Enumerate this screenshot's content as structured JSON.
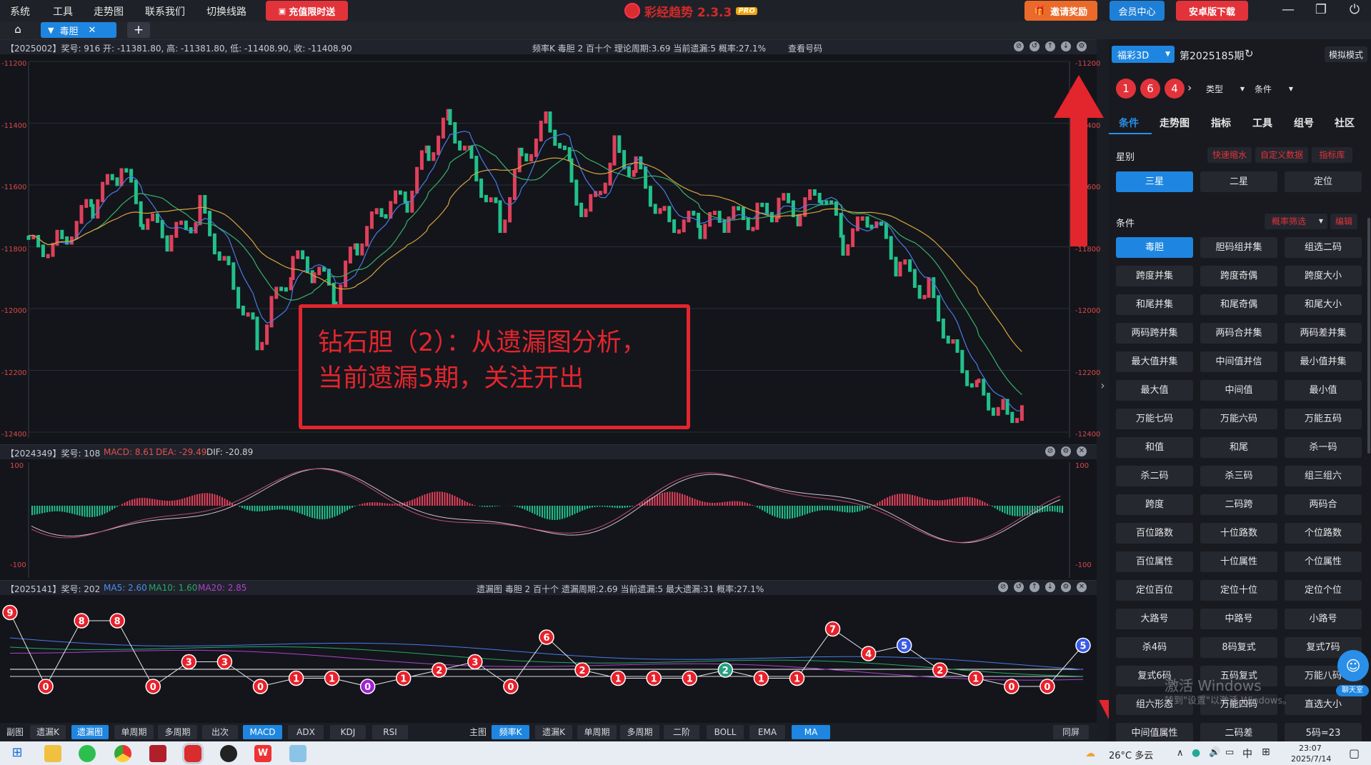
{
  "titlebar": {
    "menu": [
      "系统",
      "工具",
      "走势图",
      "联系我们",
      "切换线路"
    ],
    "promo": "充值限时送",
    "app_title": "彩经趋势 2.3.3",
    "pro": "PRO",
    "invite": "邀请奖励",
    "member": "会员中心",
    "android": "安卓版下载"
  },
  "tabbar": {
    "active_tab": "毒胆"
  },
  "kline_panel": {
    "header_left": "【2025002】奖号: 916  开: -11381.80, 高: -11381.80, 低: -11408.90, 收: -11408.90",
    "header_mid": "频率K   毒胆   2   百十个   理论周期:3.69   当前遗漏:5   概率:27.1%",
    "header_link": "查看号码",
    "y_ticks": [
      "-11200",
      "-11400",
      "-11600",
      "-11800",
      "-12000",
      "-12200",
      "-12400"
    ]
  },
  "macd_panel": {
    "header_prefix": "【2024349】奖号: 108",
    "macd": "MACD: 8.61",
    "dea": "DEA: -29.49",
    "dif": "DIF: -20.89",
    "y_ticks": [
      "100",
      "-100"
    ]
  },
  "miss_panel": {
    "header_prefix": "【2025141】奖号: 202",
    "ma5": "MA5: 2.60",
    "ma10": "MA10: 1.60",
    "ma20": "MA20: 2.85",
    "header_mid": "遗漏图   毒胆   2   百十个   遗漏周期:2.69   当前遗漏:5   最大遗漏:31   概率:27.1%",
    "values": [
      9,
      0,
      8,
      8,
      0,
      3,
      3,
      0,
      1,
      1,
      0,
      1,
      2,
      3,
      0,
      6,
      2,
      1,
      1,
      1,
      2,
      1,
      1,
      7,
      4,
      5,
      2,
      1,
      0,
      0,
      5
    ]
  },
  "toolstrip": {
    "sub_label": "副图",
    "sub_buttons": [
      "遗漏K",
      "遗漏图",
      "单周期",
      "多周期",
      "出次",
      "MACD",
      "ADX",
      "KDJ",
      "RSI"
    ],
    "main_label": "主图",
    "main_buttons": [
      "频率K",
      "遗漏K",
      "单周期",
      "多周期",
      "二阶",
      "BOLL",
      "EMA",
      "MA"
    ],
    "same_screen": "同屏"
  },
  "annotation": {
    "line1": "钻石胆（2）：从遗漏图分析，",
    "line2": "当前遗漏5期，关注开出"
  },
  "sidebar": {
    "lottery": "福彩3D",
    "period": "第2025185期",
    "mode": "模拟模式",
    "balls": [
      "1",
      "6",
      "4"
    ],
    "type_select": "类型",
    "cond_select": "条件",
    "tabs": [
      "条件",
      "走势图",
      "指标",
      "工具",
      "组号",
      "社区"
    ],
    "star_label": "星别",
    "star_links": [
      "快速缩水",
      "自定义数据",
      "指标库"
    ],
    "star_buttons": [
      "三星",
      "二星",
      "定位"
    ],
    "cond_label": "条件",
    "prob_filter": "概率筛选",
    "edit": "编辑",
    "conditions": [
      "毒胆",
      "胆码组并集",
      "组选二码",
      "跨度并集",
      "跨度奇偶",
      "跨度大小",
      "和尾并集",
      "和尾奇偶",
      "和尾大小",
      "两码跨并集",
      "两码合并集",
      "两码差并集",
      "最大值并集",
      "中间值并信",
      "最小值并集",
      "最大值",
      "中间值",
      "最小值",
      "万能七码",
      "万能六码",
      "万能五码",
      "和值",
      "和尾",
      "杀一码",
      "杀二码",
      "杀三码",
      "组三组六",
      "跨度",
      "二码跨",
      "两码合",
      "百位路数",
      "十位路数",
      "个位路数",
      "百位属性",
      "十位属性",
      "个位属性",
      "定位百位",
      "定位十位",
      "定位个位",
      "大路号",
      "中路号",
      "小路号",
      "杀4码",
      "8码复式",
      "复式7码",
      "复式6码",
      "五码复式",
      "万能八码",
      "组六形态",
      "万能四码",
      "直选大小",
      "中间值属性",
      "二码差",
      "5码=23"
    ],
    "chat": "聊天室"
  },
  "watermark": {
    "line1": "激活 Windows",
    "line2": "转到\"设置\"以激活 Windows。"
  },
  "taskbar": {
    "weather": "26°C 多云",
    "time": "23:07",
    "date": "2025/7/14",
    "ime": "中"
  }
}
